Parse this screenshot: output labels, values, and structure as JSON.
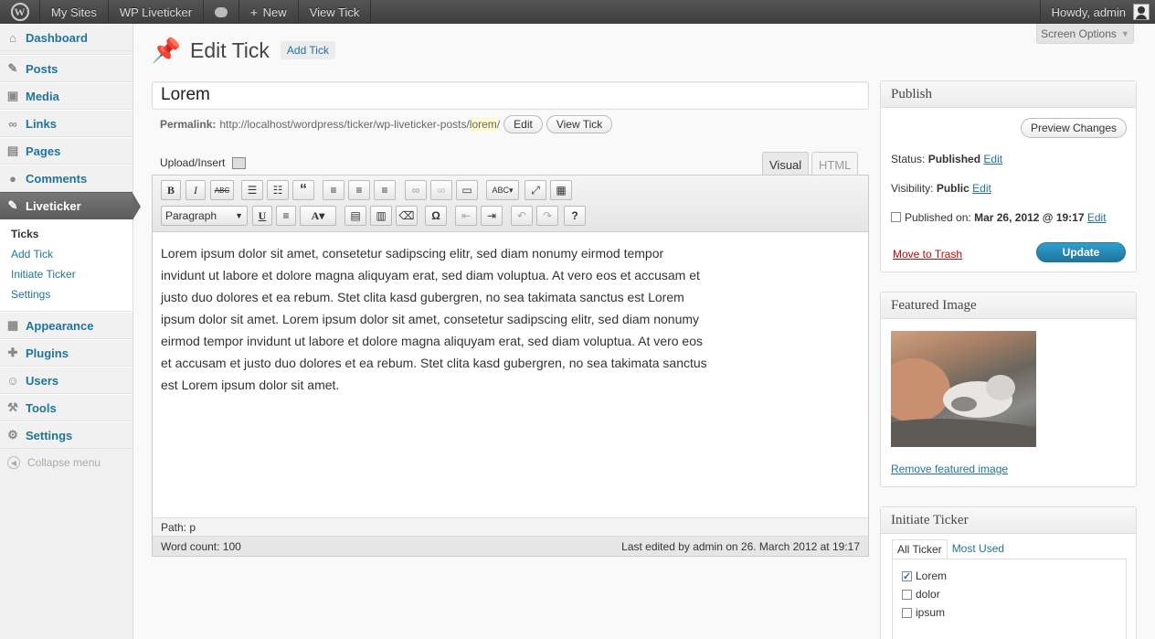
{
  "adminbar": {
    "my_sites": "My Sites",
    "site_name": "WP Liveticker",
    "new": "New",
    "view": "View Tick",
    "howdy": "Howdy, admin"
  },
  "menu": {
    "dashboard": "Dashboard",
    "posts": "Posts",
    "media": "Media",
    "links": "Links",
    "pages": "Pages",
    "comments": "Comments",
    "liveticker": "Liveticker",
    "sub": [
      "Ticks",
      "Add Tick",
      "Initiate Ticker",
      "Settings"
    ],
    "appearance": "Appearance",
    "plugins": "Plugins",
    "users": "Users",
    "tools": "Tools",
    "settings": "Settings",
    "collapse": "Collapse menu"
  },
  "screen_options": "Screen Options",
  "heading": {
    "title": "Edit Tick",
    "add_new": "Add Tick"
  },
  "post": {
    "title": "Lorem",
    "permalink_label": "Permalink:",
    "permalink_base": "http://localhost/wordpress/ticker/wp-liveticker-posts/",
    "permalink_slug": "lorem",
    "permalink_tail": "/",
    "edit_btn": "Edit",
    "view_btn": "View Tick"
  },
  "editor": {
    "upload": "Upload/Insert",
    "tab_visual": "Visual",
    "tab_html": "HTML",
    "format": "Paragraph",
    "content": "Lorem ipsum dolor sit amet, consetetur sadipscing elitr, sed diam nonumy eirmod tempor invidunt ut labore et dolore magna aliquyam erat, sed diam voluptua. At vero eos et accusam et justo duo dolores et ea rebum. Stet clita kasd gubergren, no sea takimata sanctus est Lorem ipsum dolor sit amet. Lorem ipsum dolor sit amet, consetetur sadipscing elitr, sed diam nonumy eirmod tempor invidunt ut labore et dolore magna aliquyam erat, sed diam voluptua. At vero eos et accusam et justo duo dolores et ea rebum. Stet clita kasd gubergren, no sea takimata sanctus est Lorem ipsum dolor sit amet.",
    "path": "Path: p",
    "word_count": "Word count: 100",
    "last_edited": "Last edited by admin on 26. March 2012 at 19:17"
  },
  "publish": {
    "title": "Publish",
    "preview": "Preview Changes",
    "status_label": "Status:",
    "status_value": "Published",
    "visibility_label": "Visibility:",
    "visibility_value": "Public",
    "published_label": "Published on:",
    "published_value": "Mar 26, 2012 @ 19:17",
    "edit": "Edit",
    "trash": "Move to Trash",
    "update": "Update"
  },
  "featured": {
    "title": "Featured Image",
    "remove": "Remove featured image"
  },
  "ticker_box": {
    "title": "Initiate Ticker",
    "tab_all": "All Ticker",
    "tab_most": "Most Used",
    "items": [
      {
        "label": "Lorem",
        "checked": true
      },
      {
        "label": "dolor",
        "checked": false
      },
      {
        "label": "ipsum",
        "checked": false
      }
    ]
  }
}
